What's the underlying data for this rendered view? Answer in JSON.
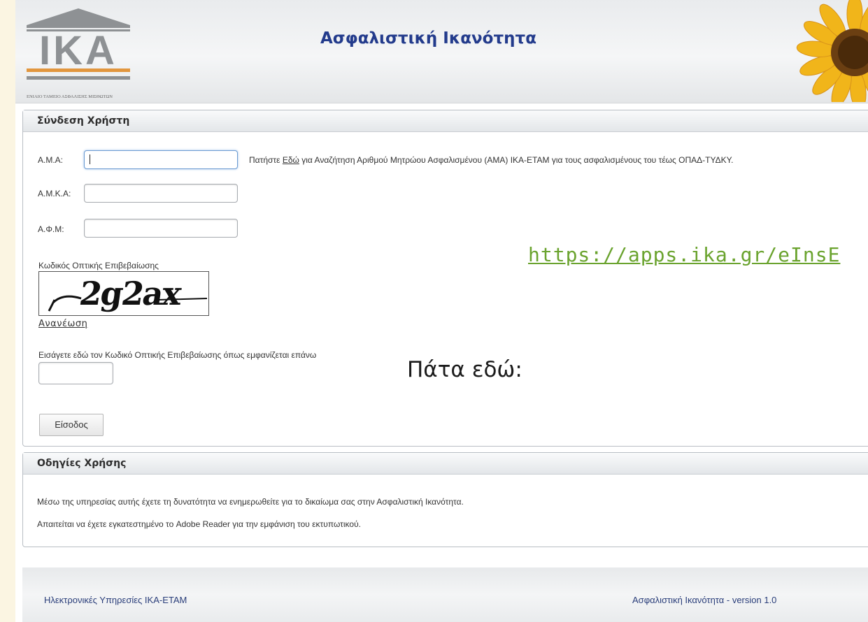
{
  "header": {
    "logo_text": "IKA",
    "logo_subtitle": "ΕΝΙΑΙΟ ΤΑΜΕΙΟ ΑΣΦΑΛΙΣΗΣ ΜΙΣΘΩΤΩΝ",
    "title": "Ασφαλιστική Ικανότητα"
  },
  "login": {
    "heading": "Σύνδεση Χρήστη",
    "ama_label": "Α.Μ.Α:",
    "ama_value": "",
    "ama_hint_prefix": "Πατήστε ",
    "ama_hint_link": "Εδώ",
    "ama_hint_suffix": " για Αναζήτηση Αριθμού Μητρώου Ασφαλισμένου (ΑΜΑ) ΙΚΑ-ΕΤΑΜ για τους ασφαλισμένους του τέως ΟΠΑΔ-ΤΥΔΚΥ.",
    "amka_label": "Α.Μ.Κ.Α:",
    "amka_value": "",
    "afm_label": "Α.Φ.Μ:",
    "afm_value": "",
    "captcha_label": "Κωδικός Οπτικής Επιβεβαίωσης",
    "captcha_text": "2g2ax",
    "refresh_label": "Ανανέωση",
    "captcha_instruction": "Εισάγετε εδώ τον Κωδικό Οπτικής Επιβεβαίωσης όπως εμφανίζεται επάνω",
    "captcha_input_value": "",
    "submit_label": "Είσοδος"
  },
  "overlay": {
    "label": "Πάτα εδώ:",
    "url": "https://apps.ika.gr/eInsE"
  },
  "instructions": {
    "heading": "Οδηγίες Χρήσης",
    "line1": "Μέσω της υπηρεσίας αυτής έχετε τη δυνατότητα να ενημερωθείτε για το δικαίωμα σας στην Ασφαλιστική Ικανότητα.",
    "line2": "Απαιτείται να έχετε εγκατεστημένο το Adobe Reader για την εμφάνιση του εκτυπωτικού."
  },
  "footer": {
    "left": "Ηλεκτρονικές Υπηρεσίες ΙΚΑ-ΕΤΑΜ",
    "right": "Ασφαλιστική Ικανότητα - version 1.0"
  },
  "colors": {
    "title_blue": "#233b8c",
    "logo_grey": "#8e9194",
    "logo_orange": "#e2963e",
    "overlay_url_green": "#6aa32e"
  }
}
